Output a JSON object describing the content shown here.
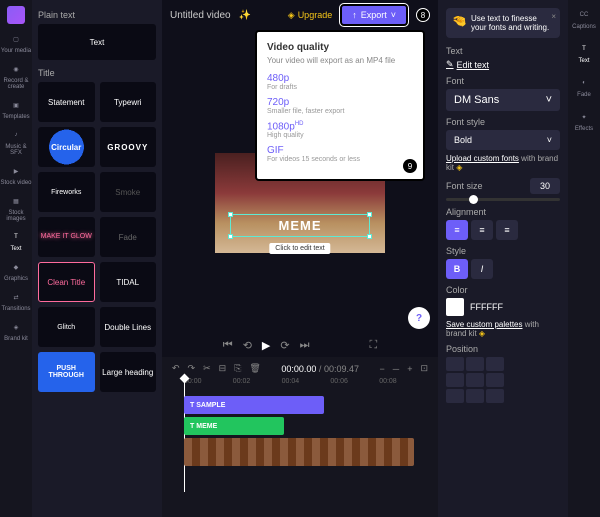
{
  "leftRail": [
    "Your media",
    "Record & create",
    "Templates",
    "Music & SFX",
    "Stock video",
    "Stock images",
    "Text",
    "Graphics",
    "Transitions",
    "Brand kit"
  ],
  "templates": {
    "plainLabel": "Plain text",
    "plain": "Text",
    "titleLabel": "Title",
    "items": [
      "Statement",
      "Typewri",
      "Circular",
      "GROOVY",
      "Fireworks",
      "Smoke",
      "MAKE IT GLOW",
      "Fade",
      "Clean Title",
      "TIDAL",
      "Glitch",
      "Double Lines",
      "PUSH THROUGH",
      "Large heading"
    ]
  },
  "topbar": {
    "title": "Untitled video",
    "upgrade": "Upgrade",
    "export": "Export",
    "badge": "8"
  },
  "exportPopup": {
    "title": "Video quality",
    "subtitle": "Your video will export as an MP4 file",
    "opts": [
      {
        "res": "480p",
        "desc": "For drafts"
      },
      {
        "res": "720p",
        "desc": "Smaller file, faster export"
      },
      {
        "res": "1080p",
        "desc": "High quality",
        "hd": "HD"
      },
      {
        "res": "GIF",
        "desc": "For videos 15 seconds or less"
      }
    ],
    "badge": "9"
  },
  "canvas": {
    "memeText": "MEME",
    "editTip": "Click to edit text"
  },
  "timeline": {
    "current": "00:00.00",
    "total": "00:09.47",
    "ruler": [
      "00:00",
      "00:02",
      "00:04",
      "00:06",
      "00:08"
    ],
    "clips": {
      "sample": "SAMPLE",
      "meme": "MEME"
    }
  },
  "props": {
    "tip": "Use text to finesse your fonts and writing.",
    "textLabel": "Text",
    "editText": "Edit text",
    "fontLabel": "Font",
    "fontValue": "DM Sans",
    "styleLabel": "Font style",
    "styleValue": "Bold",
    "uploadFonts": "Upload custom fonts",
    "withBrand": " with brand kit",
    "sizeLabel": "Font size",
    "sizeValue": "30",
    "alignLabel": "Alignment",
    "styleBtnLabel": "Style",
    "colorLabel": "Color",
    "colorValue": "FFFFFF",
    "savePalettes": "Save custom palettes",
    "positionLabel": "Position"
  },
  "rightRail": [
    "Captions",
    "Text",
    "Fade",
    "Effects"
  ]
}
